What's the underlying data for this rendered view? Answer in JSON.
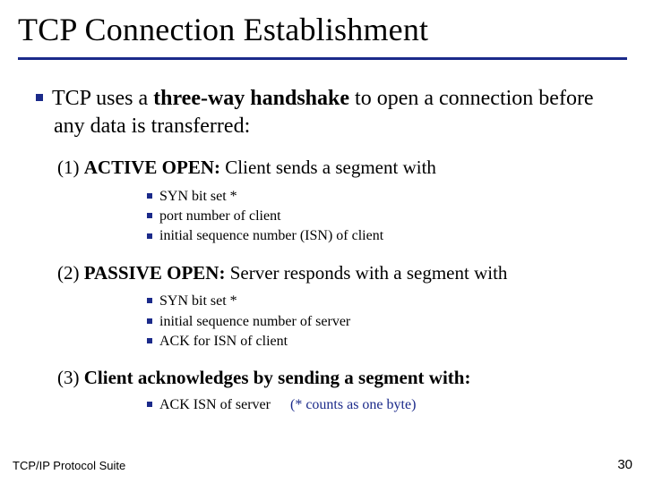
{
  "title": "TCP Connection Establishment",
  "intro": {
    "pre": "TCP uses a ",
    "bold": "three-way handshake",
    "post": " to open a connection before any data is transferred:"
  },
  "steps": [
    {
      "num": "(1)",
      "head": "ACTIVE OPEN:",
      "tail": " Client sends a segment with",
      "items": [
        "SYN bit set *",
        "port number of client",
        "initial sequence number (ISN) of client"
      ]
    },
    {
      "num": "(2)",
      "head": "PASSIVE OPEN:",
      "tail": " Server responds with a segment with",
      "items": [
        "SYN bit set *",
        "initial sequence number of server",
        "ACK for ISN of client"
      ]
    },
    {
      "num": "(3)",
      "head": "Client acknowledges by sending a segment with:",
      "tail": "",
      "ack_item": "ACK ISN of server",
      "note": "(* counts as one byte)"
    }
  ],
  "footer": {
    "left": "TCP/IP Protocol Suite",
    "page": "30"
  }
}
